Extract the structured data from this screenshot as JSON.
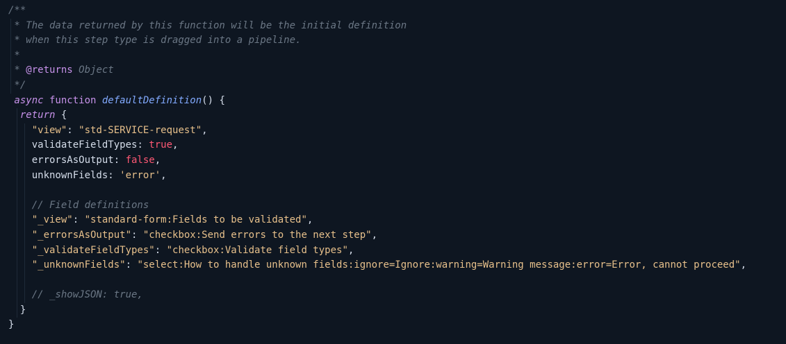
{
  "code_lines": [
    [
      {
        "t": "/**",
        "c": "cmt"
      }
    ],
    [
      {
        "t": " * The data returned by this function will be the initial definition",
        "c": "cmt"
      }
    ],
    [
      {
        "t": " * when this step type is dragged into a pipeline.",
        "c": "cmt"
      }
    ],
    [
      {
        "t": " *",
        "c": "cmt"
      }
    ],
    [
      {
        "t": " * ",
        "c": "cmt"
      },
      {
        "t": "@returns",
        "c": "tag"
      },
      {
        "t": " Object",
        "c": "tagtype"
      }
    ],
    [
      {
        "t": " */",
        "c": "cmt"
      }
    ],
    [
      {
        "t": " async",
        "c": "kwi"
      },
      {
        "t": " function ",
        "c": "kw"
      },
      {
        "t": "defaultDefinition",
        "c": "fn"
      },
      {
        "t": "() {",
        "c": "punc"
      }
    ],
    [
      {
        "t": "  return",
        "c": "kwi"
      },
      {
        "t": " {",
        "c": "punc"
      }
    ],
    [
      {
        "t": "    ",
        "c": "plain"
      },
      {
        "t": "\"view\"",
        "c": "str"
      },
      {
        "t": ": ",
        "c": "punc"
      },
      {
        "t": "\"std-SERVICE-request\"",
        "c": "str"
      },
      {
        "t": ",",
        "c": "punc"
      }
    ],
    [
      {
        "t": "    validateFieldTypes",
        "c": "prop"
      },
      {
        "t": ": ",
        "c": "punc"
      },
      {
        "t": "true",
        "c": "bool"
      },
      {
        "t": ",",
        "c": "punc"
      }
    ],
    [
      {
        "t": "    errorsAsOutput",
        "c": "prop"
      },
      {
        "t": ": ",
        "c": "punc"
      },
      {
        "t": "false",
        "c": "bool"
      },
      {
        "t": ",",
        "c": "punc"
      }
    ],
    [
      {
        "t": "    unknownFields",
        "c": "prop"
      },
      {
        "t": ": ",
        "c": "punc"
      },
      {
        "t": "'error'",
        "c": "str"
      },
      {
        "t": ",",
        "c": "punc"
      }
    ],
    [
      {
        "t": "",
        "c": "plain"
      }
    ],
    [
      {
        "t": "    ",
        "c": "plain"
      },
      {
        "t": "// Field definitions",
        "c": "cmt"
      }
    ],
    [
      {
        "t": "    ",
        "c": "plain"
      },
      {
        "t": "\"_view\"",
        "c": "str"
      },
      {
        "t": ": ",
        "c": "punc"
      },
      {
        "t": "\"standard-form:Fields to be validated\"",
        "c": "str"
      },
      {
        "t": ",",
        "c": "punc"
      }
    ],
    [
      {
        "t": "    ",
        "c": "plain"
      },
      {
        "t": "\"_errorsAsOutput\"",
        "c": "str"
      },
      {
        "t": ": ",
        "c": "punc"
      },
      {
        "t": "\"checkbox:Send errors to the next step\"",
        "c": "str"
      },
      {
        "t": ",",
        "c": "punc"
      }
    ],
    [
      {
        "t": "    ",
        "c": "plain"
      },
      {
        "t": "\"_validateFieldTypes\"",
        "c": "str"
      },
      {
        "t": ": ",
        "c": "punc"
      },
      {
        "t": "\"checkbox:Validate field types\"",
        "c": "str"
      },
      {
        "t": ",",
        "c": "punc"
      }
    ],
    [
      {
        "t": "    ",
        "c": "plain"
      },
      {
        "t": "\"_unknownFields\"",
        "c": "str"
      },
      {
        "t": ": ",
        "c": "punc"
      },
      {
        "t": "\"select:How to handle unknown fields:ignore=Ignore:warning=Warning message:error=Error, cannot proceed\"",
        "c": "str"
      },
      {
        "t": ",",
        "c": "punc"
      }
    ],
    [
      {
        "t": "",
        "c": "plain"
      }
    ],
    [
      {
        "t": "    ",
        "c": "plain"
      },
      {
        "t": "// _showJSON: true,",
        "c": "cmt"
      }
    ],
    [
      {
        "t": "  }",
        "c": "punc"
      }
    ],
    [
      {
        "t": "}",
        "c": "punc"
      }
    ]
  ]
}
